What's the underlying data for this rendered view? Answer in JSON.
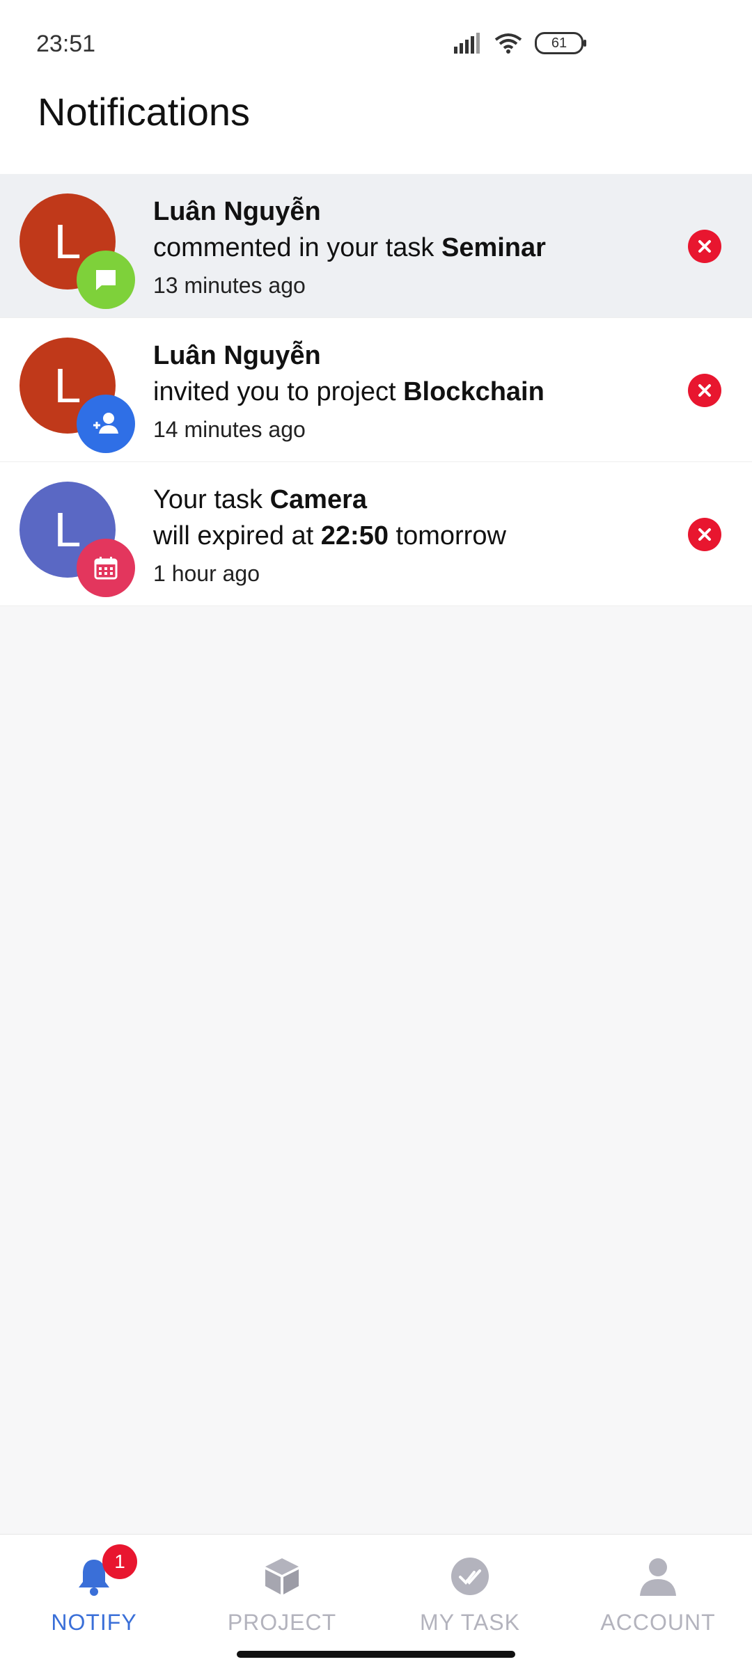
{
  "status_bar": {
    "time": "23:51",
    "battery": "61"
  },
  "header": {
    "title": "Notifications"
  },
  "notifications": [
    {
      "avatar_letter": "L",
      "avatar_color": "#c0391a",
      "badge_color": "#7ed13a",
      "badge_icon": "comment-icon",
      "actor": "Luân Nguyễn",
      "action": "commented in your task ",
      "target": "Seminar",
      "time": "13 minutes ago"
    },
    {
      "avatar_letter": "L",
      "avatar_color": "#c0391a",
      "badge_color": "#2f6fe6",
      "badge_icon": "add-user-icon",
      "actor": "Luân Nguyễn",
      "action": "invited you to project ",
      "target": "Blockchain",
      "time": "14 minutes ago"
    },
    {
      "avatar_letter": "L",
      "avatar_color": "#5a68c4",
      "badge_color": "#e3365d",
      "badge_icon": "calendar-icon",
      "line1_prefix": "Your task ",
      "line1_bold": "Camera",
      "line2_prefix": "will expired at ",
      "line2_bold": "22:50",
      "line2_suffix": " tomorrow",
      "time": "1 hour ago"
    }
  ],
  "bottom_nav": {
    "items": [
      {
        "label": "NOTIFY",
        "icon": "bell-icon",
        "active": true,
        "badge": "1"
      },
      {
        "label": "PROJECT",
        "icon": "cube-icon",
        "active": false
      },
      {
        "label": "MY TASK",
        "icon": "check-circle-icon",
        "active": false
      },
      {
        "label": "ACCOUNT",
        "icon": "person-icon",
        "active": false
      }
    ]
  },
  "colors": {
    "accent": "#3a6fd8",
    "delete": "#e8162f",
    "inactive": "#b3b3bd"
  }
}
